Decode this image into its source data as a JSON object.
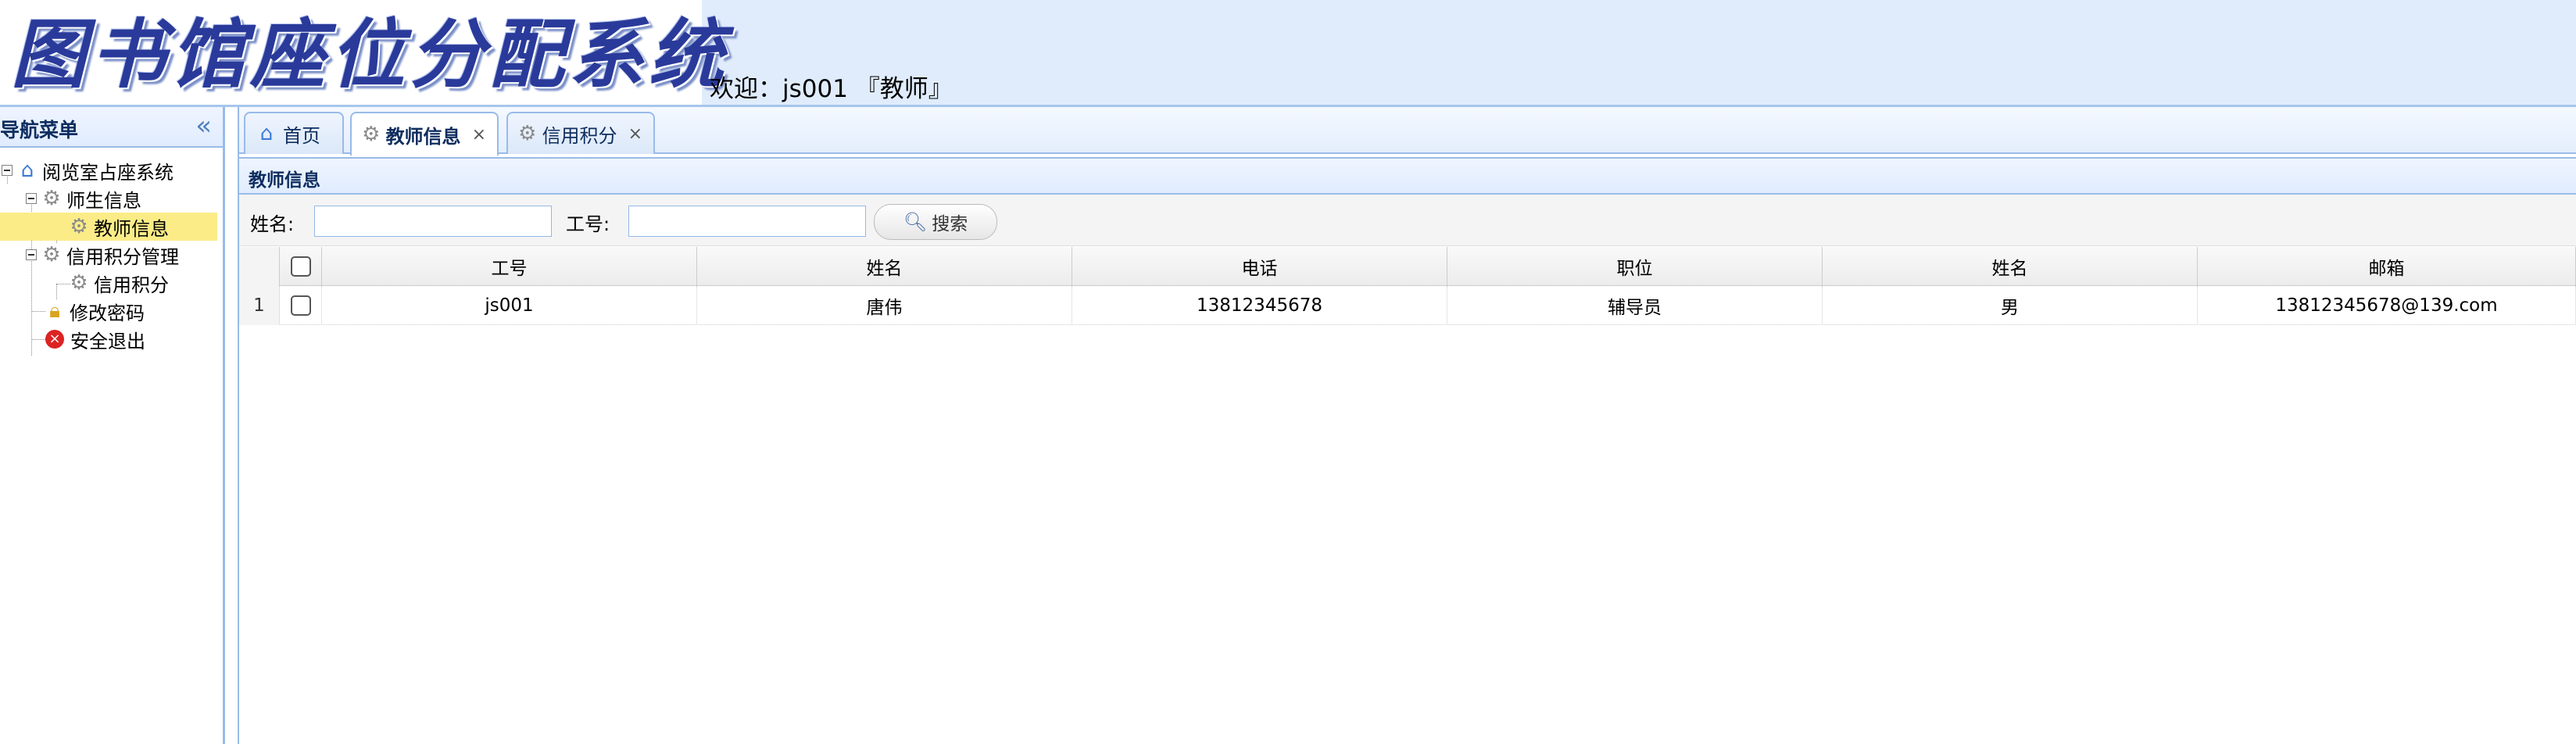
{
  "header": {
    "app_title": "图书馆座位分配系统",
    "welcome": "欢迎：js001 『教师』"
  },
  "nav": {
    "title": "导航菜单",
    "collapse_icon": "double-chevron-left-icon",
    "tree": {
      "root": "阅览室占座系统",
      "teacher_student_info": "师生信息",
      "teacher_info": "教师信息",
      "credit_mgmt": "信用积分管理",
      "credit_points": "信用积分",
      "change_password": "修改密码",
      "safe_exit": "安全退出"
    }
  },
  "tabs": [
    {
      "label": "首页",
      "icon": "home-icon",
      "closable": false
    },
    {
      "label": "教师信息",
      "icon": "gear-icon",
      "closable": true,
      "active": true
    },
    {
      "label": "信用积分",
      "icon": "gear-icon",
      "closable": true
    }
  ],
  "tab_close_glyph": "×",
  "panel": {
    "title": "教师信息",
    "search": {
      "name_label": "姓名:",
      "name_value": "",
      "id_label": "工号:",
      "id_value": "",
      "button_label": "搜索"
    }
  },
  "grid": {
    "columns": [
      "工号",
      "姓名",
      "电话",
      "职位",
      "姓名",
      "邮箱"
    ],
    "rows": [
      {
        "rownum": "1",
        "cells": [
          "js001",
          "唐伟",
          "13812345678",
          "辅导员",
          "男",
          "13812345678@139.com"
        ]
      }
    ]
  },
  "colors": {
    "header_bg": "#e0ecfb",
    "panel_border": "#99bbe8",
    "selected_node": "#fbec88",
    "title_blue": "#2a3a9a"
  }
}
